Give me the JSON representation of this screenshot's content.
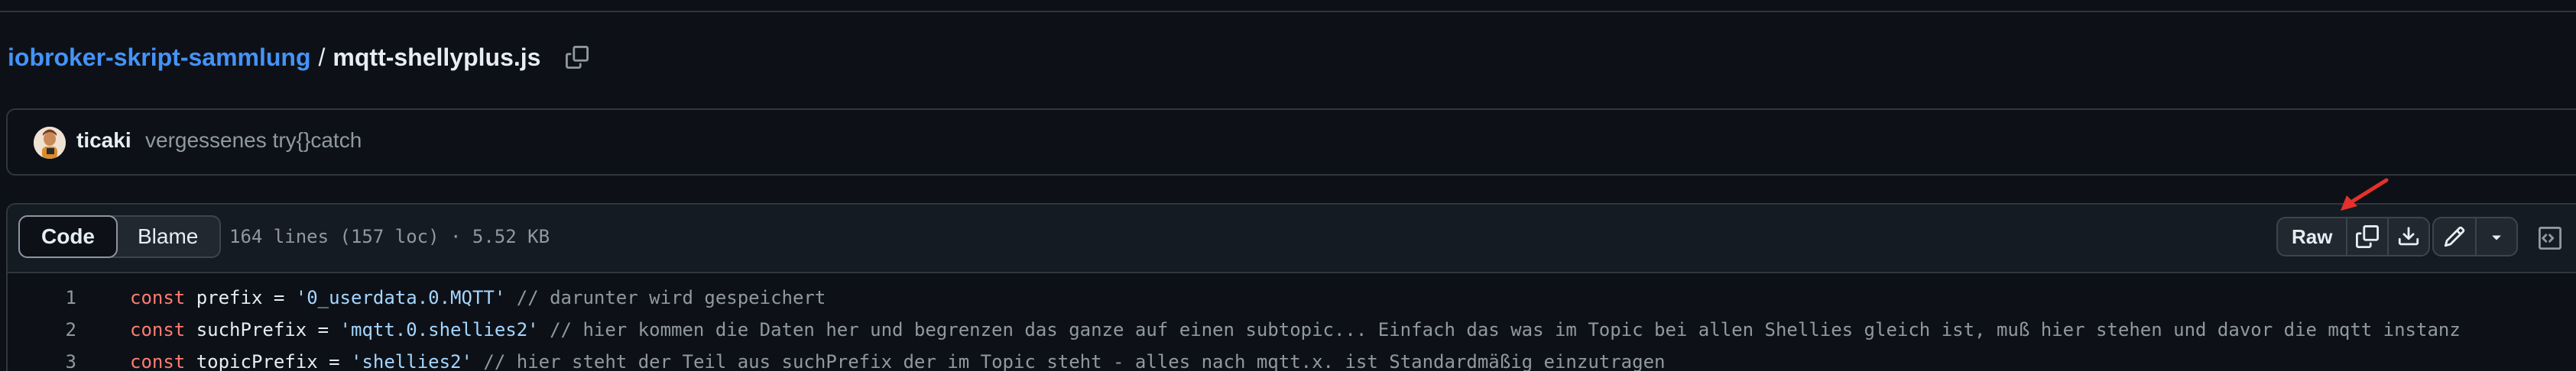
{
  "breadcrumb": {
    "repo": "iobroker-skript-sammlung",
    "separator": "/",
    "file": "mqtt-shellyplus.js"
  },
  "commit": {
    "author": "ticaki",
    "message": "vergessenes try{}catch"
  },
  "file_header": {
    "tabs": [
      {
        "label": "Code",
        "active": true
      },
      {
        "label": "Blame",
        "active": false
      }
    ],
    "meta": "164 lines (157 loc) · 5.52 KB",
    "raw_label": "Raw"
  },
  "icons": {
    "copy_path": "copy-icon",
    "copy_raw": "copy-icon",
    "download": "download-icon",
    "edit": "pencil-icon",
    "more": "triangle-down-icon",
    "symbols": "code-square-icon",
    "annotation": "red-arrow"
  },
  "colors": {
    "link": "#4493f8",
    "keyword": "#ff7b72",
    "string": "#a5d6ff",
    "comment": "#9198a1",
    "annotation": "#e5312b"
  },
  "code": {
    "lines": [
      {
        "number": "1",
        "keyword": "const",
        "ident": " prefix = ",
        "string": "'0_userdata.0.MQTT'",
        "comment": " // darunter wird gespeichert"
      },
      {
        "number": "2",
        "keyword": "const",
        "ident": " suchPrefix = ",
        "string": "'mqtt.0.shellies2'",
        "comment": " // hier kommen die Daten her und begrenzen das ganze auf einen subtopic... Einfach das was im Topic bei allen Shellies gleich ist, muß hier stehen und davor die mqtt instanz"
      },
      {
        "number": "3",
        "keyword": "const",
        "ident": " topicPrefix = ",
        "string": "'shellies2'",
        "comment": " // hier steht der Teil aus suchPrefix der im Topic steht - alles nach mqtt.x. ist Standardmäßig einzutragen"
      }
    ]
  }
}
